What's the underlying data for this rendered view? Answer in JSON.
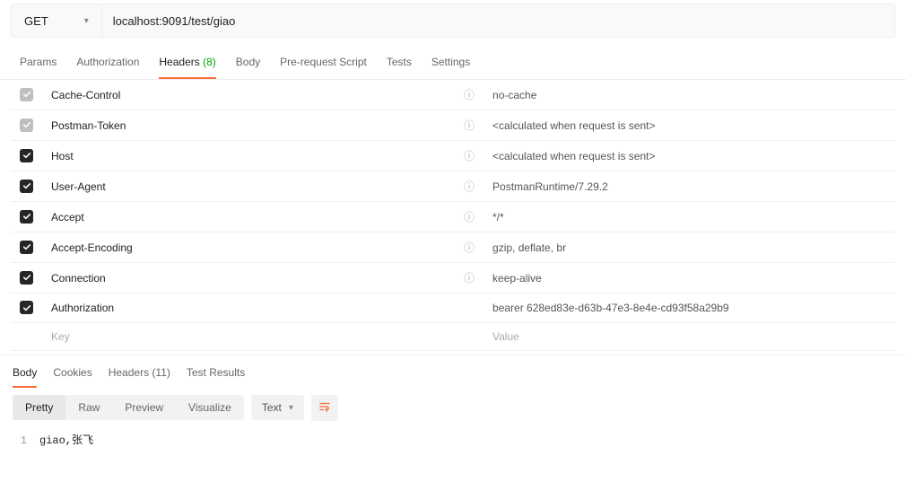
{
  "request": {
    "method": "GET",
    "url": "localhost:9091/test/giao"
  },
  "tabs": {
    "params": "Params",
    "authorization": "Authorization",
    "headers_label": "Headers",
    "headers_count": "(8)",
    "body": "Body",
    "prerequest": "Pre-request Script",
    "tests": "Tests",
    "settings": "Settings"
  },
  "headers_rows": [
    {
      "enabled": false,
      "key": "Cache-Control",
      "value": "no-cache",
      "info": true
    },
    {
      "enabled": false,
      "key": "Postman-Token",
      "value": "<calculated when request is sent>",
      "info": true
    },
    {
      "enabled": true,
      "key": "Host",
      "value": "<calculated when request is sent>",
      "info": true
    },
    {
      "enabled": true,
      "key": "User-Agent",
      "value": "PostmanRuntime/7.29.2",
      "info": true
    },
    {
      "enabled": true,
      "key": "Accept",
      "value": "*/*",
      "info": true
    },
    {
      "enabled": true,
      "key": "Accept-Encoding",
      "value": "gzip, deflate, br",
      "info": true
    },
    {
      "enabled": true,
      "key": "Connection",
      "value": "keep-alive",
      "info": true
    },
    {
      "enabled": true,
      "key": "Authorization",
      "value": "bearer 628ed83e-d63b-47e3-8e4e-cd93f58a29b9",
      "info": false
    }
  ],
  "headers_placeholder": {
    "key": "Key",
    "value": "Value"
  },
  "response_tabs": {
    "body": "Body",
    "cookies": "Cookies",
    "headers_label": "Headers",
    "headers_count": "(11)",
    "test_results": "Test Results"
  },
  "view_mode": {
    "pretty": "Pretty",
    "raw": "Raw",
    "preview": "Preview",
    "visualize": "Visualize"
  },
  "format_select": "Text",
  "response_body": {
    "line1": "giao,张飞"
  }
}
